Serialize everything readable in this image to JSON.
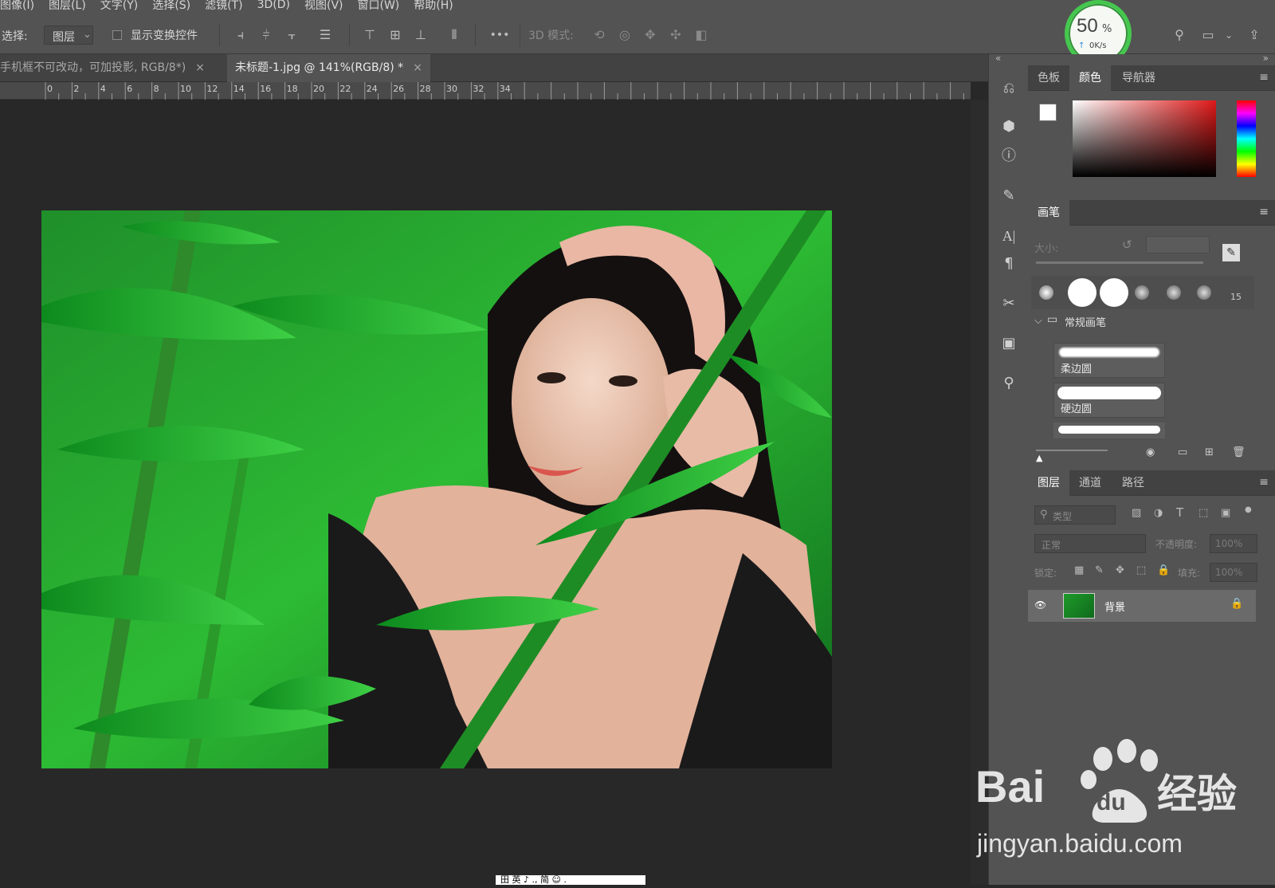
{
  "menu": [
    "图像(I)",
    "图层(L)",
    "文字(Y)",
    "选择(S)",
    "滤镜(T)",
    "3D(D)",
    "视图(V)",
    "窗口(W)",
    "帮助(H)"
  ],
  "options": {
    "select_label": "选择:",
    "select_value": "图层",
    "show_transform": "显示变换控件",
    "mode_3d": "3D 模式:",
    "more": "•••"
  },
  "tabs": [
    {
      "label": "手机框不可改动，可加投影, RGB/8*)",
      "close": "×"
    },
    {
      "label": "未标题-1.jpg @ 141%(RGB/8) *",
      "close": "×"
    }
  ],
  "ruler": [
    "0",
    "2",
    "4",
    "6",
    "8",
    "10",
    "12",
    "14",
    "16",
    "18",
    "20",
    "22",
    "24",
    "26",
    "28",
    "30",
    "32",
    "34"
  ],
  "gauge": {
    "value": "50",
    "unit": "%",
    "speed": "0K/s"
  },
  "color_panel": {
    "tabs": [
      "色板",
      "颜色",
      "导航器"
    ],
    "active": 1
  },
  "brush_panel": {
    "title": "画笔",
    "size_label": "大小:",
    "preset_size": "15",
    "folder": "常规画笔",
    "brushes": [
      "柔边圆",
      "硬边圆"
    ]
  },
  "layers_panel": {
    "tabs": [
      "图层",
      "通道",
      "路径"
    ],
    "filter_placeholder": "类型",
    "blend": "正常",
    "opacity_label": "不透明度:",
    "opacity": "100%",
    "lock_label": "锁定:",
    "fill_label": "填充:",
    "fill": "100%",
    "layer_name": "背景"
  },
  "watermark": {
    "brand": "Bai",
    "brand2": "du",
    "product": "经验",
    "url": "jingyan.baidu.com"
  },
  "ime_text": "田 英 ♪ ., 简 ☺ ."
}
